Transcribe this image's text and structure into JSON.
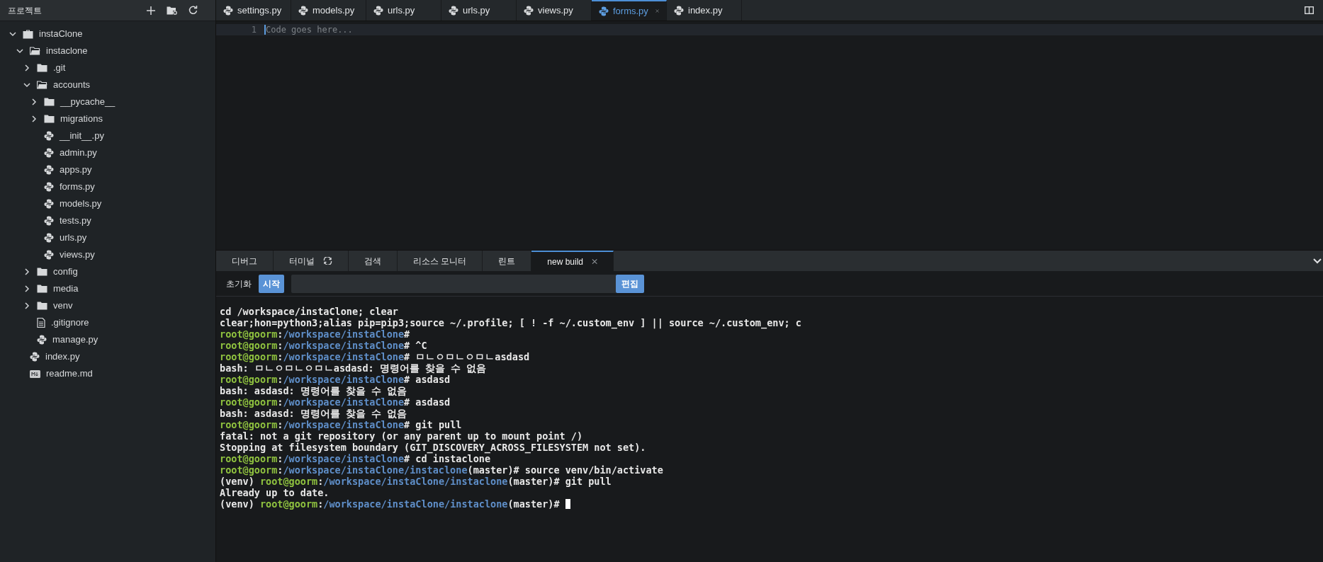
{
  "sidebar": {
    "title": "프로젝트",
    "tree": [
      {
        "name": "instaClone",
        "kind": "project",
        "expanded": true,
        "children": [
          {
            "name": "instaclone",
            "kind": "folder",
            "expanded": true,
            "children": [
              {
                "name": ".git",
                "kind": "folder",
                "expanded": false
              },
              {
                "name": "accounts",
                "kind": "folder",
                "expanded": true,
                "children": [
                  {
                    "name": "__pycache__",
                    "kind": "folder",
                    "expanded": false
                  },
                  {
                    "name": "migrations",
                    "kind": "folder",
                    "expanded": false
                  },
                  {
                    "name": "__init__.py",
                    "kind": "python"
                  },
                  {
                    "name": "admin.py",
                    "kind": "python"
                  },
                  {
                    "name": "apps.py",
                    "kind": "python"
                  },
                  {
                    "name": "forms.py",
                    "kind": "python"
                  },
                  {
                    "name": "models.py",
                    "kind": "python"
                  },
                  {
                    "name": "tests.py",
                    "kind": "python"
                  },
                  {
                    "name": "urls.py",
                    "kind": "python"
                  },
                  {
                    "name": "views.py",
                    "kind": "python"
                  }
                ]
              },
              {
                "name": "config",
                "kind": "folder",
                "expanded": false
              },
              {
                "name": "media",
                "kind": "folder",
                "expanded": false
              },
              {
                "name": "venv",
                "kind": "folder",
                "expanded": false
              },
              {
                "name": ".gitignore",
                "kind": "text"
              },
              {
                "name": "manage.py",
                "kind": "python"
              }
            ]
          },
          {
            "name": "index.py",
            "kind": "python"
          },
          {
            "name": "readme.md",
            "kind": "markdown"
          }
        ]
      }
    ]
  },
  "editor_tabs": [
    {
      "label": "settings.py",
      "selected": false
    },
    {
      "label": "models.py",
      "selected": false
    },
    {
      "label": "urls.py",
      "selected": false
    },
    {
      "label": "urls.py",
      "selected": false
    },
    {
      "label": "views.py",
      "selected": false
    },
    {
      "label": "forms.py",
      "selected": true
    },
    {
      "label": "index.py",
      "selected": false
    }
  ],
  "editor": {
    "line_number": "1",
    "placeholder": "Code goes here..."
  },
  "panel_tabs": [
    {
      "label": "디버그",
      "selected": false
    },
    {
      "label": "터미널",
      "selected": false,
      "refresh": true
    },
    {
      "label": "검색",
      "selected": false
    },
    {
      "label": "리소스 모니터",
      "selected": false
    },
    {
      "label": "린트",
      "selected": false
    },
    {
      "label": "new build",
      "selected": true
    }
  ],
  "build_bar": {
    "reset": "초기화",
    "start": "시작",
    "edit": "편집"
  },
  "terminal": [
    [
      {
        "kind": "plain",
        "text": "cd /workspace/instaClone; clear"
      }
    ],
    [
      {
        "kind": "plain",
        "text": "clear;hon=python3;alias pip=pip3;source ~/.profile; [ ! -f ~/.custom_env ] || source ~/.custom_env; c"
      }
    ],
    [
      {
        "kind": "user",
        "text": "root@goorm"
      },
      {
        "kind": "plain",
        "text": ":"
      },
      {
        "kind": "path",
        "text": "/workspace/instaClone"
      },
      {
        "kind": "plain",
        "text": "#"
      }
    ],
    [
      {
        "kind": "user",
        "text": "root@goorm"
      },
      {
        "kind": "plain",
        "text": ":"
      },
      {
        "kind": "path",
        "text": "/workspace/instaClone"
      },
      {
        "kind": "plain",
        "text": "# ^C"
      }
    ],
    [
      {
        "kind": "user",
        "text": "root@goorm"
      },
      {
        "kind": "plain",
        "text": ":"
      },
      {
        "kind": "path",
        "text": "/workspace/instaClone"
      },
      {
        "kind": "plain",
        "text": "# ㅁㄴㅇㅁㄴㅇㅁㄴasdasd"
      }
    ],
    [
      {
        "kind": "plain",
        "text": "bash: ㅁㄴㅇㅁㄴㅇㅁㄴasdasd: 명령어를 찾을 수 없음"
      }
    ],
    [
      {
        "kind": "user",
        "text": "root@goorm"
      },
      {
        "kind": "plain",
        "text": ":"
      },
      {
        "kind": "path",
        "text": "/workspace/instaClone"
      },
      {
        "kind": "plain",
        "text": "# asdasd"
      }
    ],
    [
      {
        "kind": "plain",
        "text": "bash: asdasd: 명령어를 찾을 수 없음"
      }
    ],
    [
      {
        "kind": "user",
        "text": "root@goorm"
      },
      {
        "kind": "plain",
        "text": ":"
      },
      {
        "kind": "path",
        "text": "/workspace/instaClone"
      },
      {
        "kind": "plain",
        "text": "# asdasd"
      }
    ],
    [
      {
        "kind": "plain",
        "text": "bash: asdasd: 명령어를 찾을 수 없음"
      }
    ],
    [
      {
        "kind": "user",
        "text": "root@goorm"
      },
      {
        "kind": "plain",
        "text": ":"
      },
      {
        "kind": "path",
        "text": "/workspace/instaClone"
      },
      {
        "kind": "plain",
        "text": "# git pull"
      }
    ],
    [
      {
        "kind": "plain",
        "text": "fatal: not a git repository (or any parent up to mount point /)"
      }
    ],
    [
      {
        "kind": "plain",
        "text": "Stopping at filesystem boundary (GIT_DISCOVERY_ACROSS_FILESYSTEM not set)."
      }
    ],
    [
      {
        "kind": "user",
        "text": "root@goorm"
      },
      {
        "kind": "plain",
        "text": ":"
      },
      {
        "kind": "path",
        "text": "/workspace/instaClone"
      },
      {
        "kind": "plain",
        "text": "# cd instaclone"
      }
    ],
    [
      {
        "kind": "user",
        "text": "root@goorm"
      },
      {
        "kind": "plain",
        "text": ":"
      },
      {
        "kind": "path",
        "text": "/workspace/instaClone/instaclone"
      },
      {
        "kind": "plain",
        "text": "(master)# source venv/bin/activate"
      }
    ],
    [
      {
        "kind": "plain",
        "text": "(venv) "
      },
      {
        "kind": "user",
        "text": "root@goorm"
      },
      {
        "kind": "plain",
        "text": ":"
      },
      {
        "kind": "path",
        "text": "/workspace/instaClone/instaclone"
      },
      {
        "kind": "plain",
        "text": "(master)# git pull"
      }
    ],
    [
      {
        "kind": "plain",
        "text": "Already up to date."
      }
    ],
    [
      {
        "kind": "plain",
        "text": "(venv) "
      },
      {
        "kind": "user",
        "text": "root@goorm"
      },
      {
        "kind": "plain",
        "text": ":"
      },
      {
        "kind": "path",
        "text": "/workspace/instaClone/instaclone"
      },
      {
        "kind": "plain",
        "text": "(master)# "
      }
    ]
  ]
}
